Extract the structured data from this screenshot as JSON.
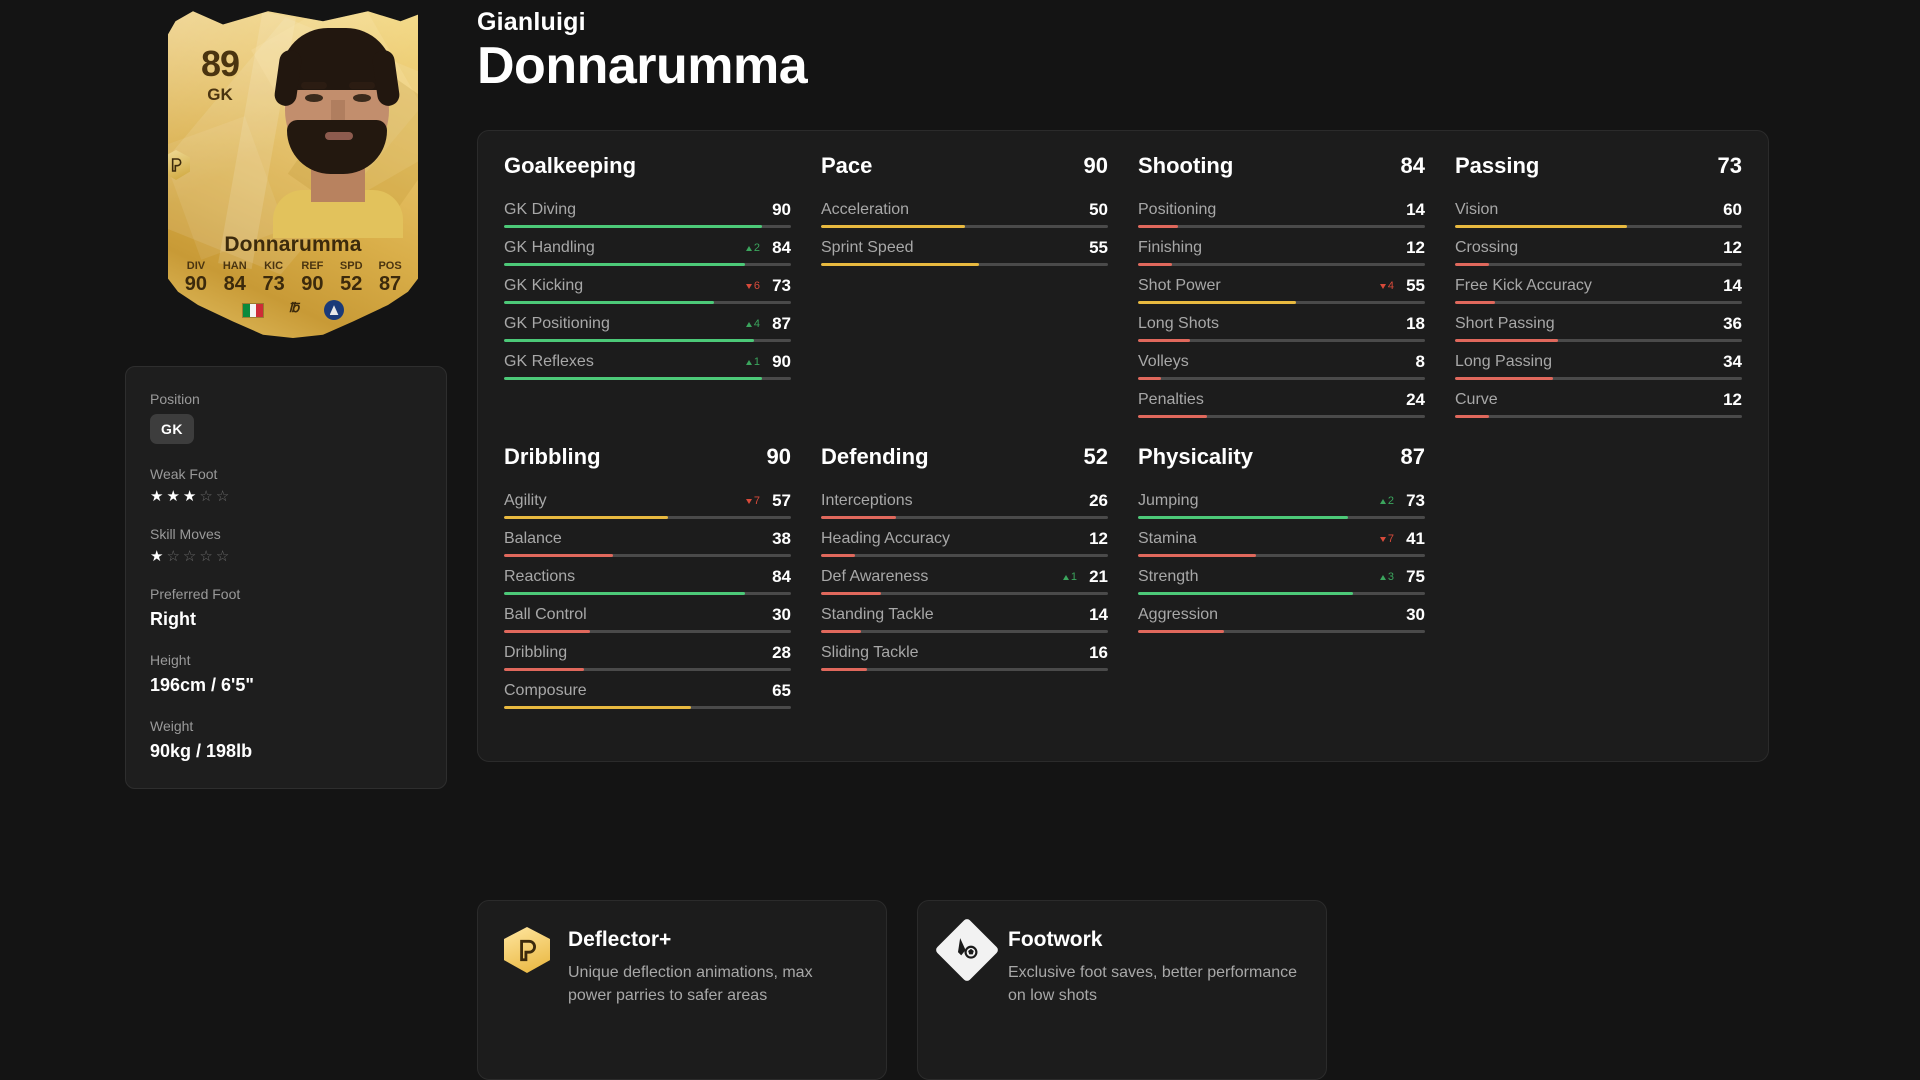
{
  "player": {
    "first_name": "Gianluigi",
    "last_name": "Donnarumma",
    "card": {
      "rating": "89",
      "position": "GK",
      "name": "Donnarumma",
      "stats": [
        {
          "key": "DIV",
          "value": "90"
        },
        {
          "key": "HAN",
          "value": "84"
        },
        {
          "key": "KIC",
          "value": "73"
        },
        {
          "key": "REF",
          "value": "90"
        },
        {
          "key": "SPD",
          "value": "52"
        },
        {
          "key": "POS",
          "value": "87"
        }
      ],
      "nation_icon": "italy-flag-icon",
      "league_icon": "serie-a-logo-icon",
      "club_icon": "psg-crest-icon"
    }
  },
  "info": {
    "position_label": "Position",
    "position_value": "GK",
    "weak_foot_label": "Weak Foot",
    "weak_foot": 3,
    "skill_moves_label": "Skill Moves",
    "skill_moves": 1,
    "star_max": 5,
    "preferred_foot_label": "Preferred Foot",
    "preferred_foot_value": "Right",
    "height_label": "Height",
    "height_value": "196cm / 6'5\"",
    "weight_label": "Weight",
    "weight_value": "90kg / 198lb"
  },
  "colors": {
    "high": "#4cc978",
    "mid": "#e8b93f",
    "low": "#e0685c",
    "track": "#4a4a4a",
    "gold": "#e8b53c",
    "up": "#3ba55d",
    "down": "#d84a3a"
  },
  "stat_groups": [
    {
      "title": "Goalkeeping",
      "total": "",
      "stats": [
        {
          "name": "GK Diving",
          "value": 90,
          "mod": null
        },
        {
          "name": "GK Handling",
          "value": 84,
          "mod": {
            "dir": "up",
            "amount": "2"
          }
        },
        {
          "name": "GK Kicking",
          "value": 73,
          "mod": {
            "dir": "down",
            "amount": "6"
          }
        },
        {
          "name": "GK Positioning",
          "value": 87,
          "mod": {
            "dir": "up",
            "amount": "4"
          }
        },
        {
          "name": "GK Reflexes",
          "value": 90,
          "mod": {
            "dir": "up",
            "amount": "1"
          }
        }
      ]
    },
    {
      "title": "Pace",
      "total": "90",
      "stats": [
        {
          "name": "Acceleration",
          "value": 50,
          "mod": null
        },
        {
          "name": "Sprint Speed",
          "value": 55,
          "mod": null
        }
      ]
    },
    {
      "title": "Shooting",
      "total": "84",
      "stats": [
        {
          "name": "Positioning",
          "value": 14,
          "mod": null
        },
        {
          "name": "Finishing",
          "value": 12,
          "mod": null
        },
        {
          "name": "Shot Power",
          "value": 55,
          "mod": {
            "dir": "down",
            "amount": "4"
          }
        },
        {
          "name": "Long Shots",
          "value": 18,
          "mod": null
        },
        {
          "name": "Volleys",
          "value": 8,
          "mod": null
        },
        {
          "name": "Penalties",
          "value": 24,
          "mod": null
        }
      ]
    },
    {
      "title": "Passing",
      "total": "73",
      "stats": [
        {
          "name": "Vision",
          "value": 60,
          "mod": null
        },
        {
          "name": "Crossing",
          "value": 12,
          "mod": null
        },
        {
          "name": "Free Kick Accuracy",
          "value": 14,
          "mod": null
        },
        {
          "name": "Short Passing",
          "value": 36,
          "mod": null
        },
        {
          "name": "Long Passing",
          "value": 34,
          "mod": null
        },
        {
          "name": "Curve",
          "value": 12,
          "mod": null
        }
      ]
    },
    {
      "title": "Dribbling",
      "total": "90",
      "stats": [
        {
          "name": "Agility",
          "value": 57,
          "mod": {
            "dir": "down",
            "amount": "7"
          }
        },
        {
          "name": "Balance",
          "value": 38,
          "mod": null
        },
        {
          "name": "Reactions",
          "value": 84,
          "mod": null
        },
        {
          "name": "Ball Control",
          "value": 30,
          "mod": null
        },
        {
          "name": "Dribbling",
          "value": 28,
          "mod": null
        },
        {
          "name": "Composure",
          "value": 65,
          "mod": null
        }
      ]
    },
    {
      "title": "Defending",
      "total": "52",
      "stats": [
        {
          "name": "Interceptions",
          "value": 26,
          "mod": null
        },
        {
          "name": "Heading Accuracy",
          "value": 12,
          "mod": null
        },
        {
          "name": "Def Awareness",
          "value": 21,
          "mod": {
            "dir": "up",
            "amount": "1"
          }
        },
        {
          "name": "Standing Tackle",
          "value": 14,
          "mod": null
        },
        {
          "name": "Sliding Tackle",
          "value": 16,
          "mod": null
        }
      ]
    },
    {
      "title": "Physicality",
      "total": "87",
      "stats": [
        {
          "name": "Jumping",
          "value": 73,
          "mod": {
            "dir": "up",
            "amount": "2"
          }
        },
        {
          "name": "Stamina",
          "value": 41,
          "mod": {
            "dir": "down",
            "amount": "7"
          }
        },
        {
          "name": "Strength",
          "value": 75,
          "mod": {
            "dir": "up",
            "amount": "3"
          }
        },
        {
          "name": "Aggression",
          "value": 30,
          "mod": null
        }
      ]
    }
  ],
  "playstyles": [
    {
      "name": "Deflector+",
      "desc": "Unique deflection animations, max power parries to safer areas",
      "icon": "deflector-plus-icon",
      "style": "gold"
    },
    {
      "name": "Footwork",
      "desc": "Exclusive foot saves, better performance on low shots",
      "icon": "footwork-icon",
      "style": "white"
    }
  ]
}
